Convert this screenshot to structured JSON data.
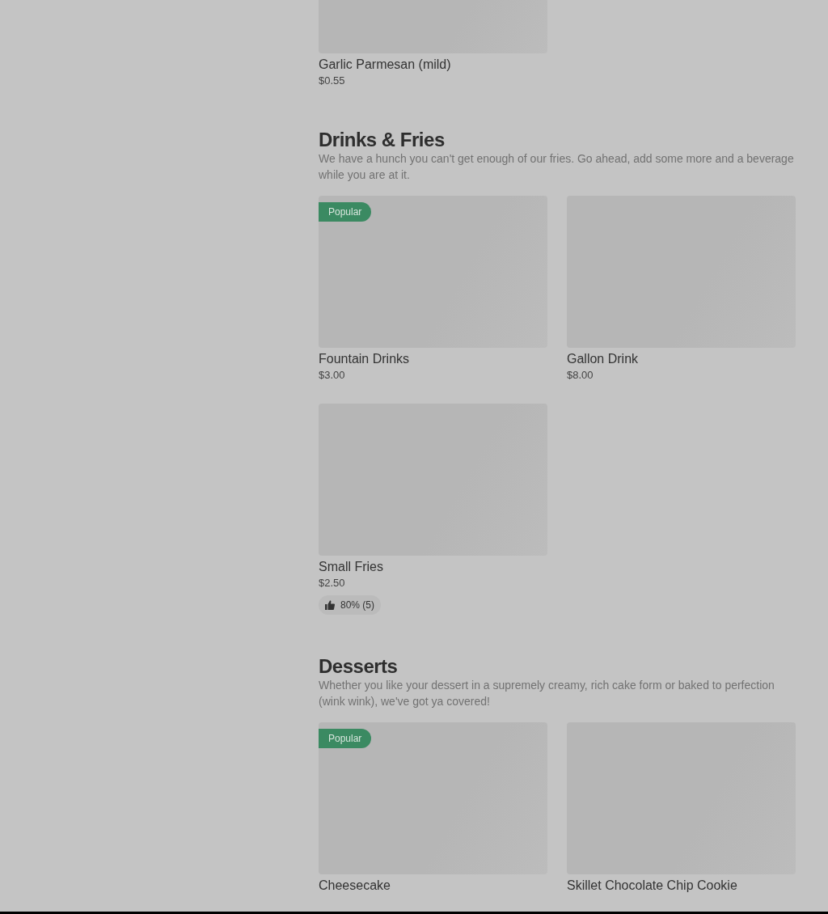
{
  "sections": [
    {
      "items": [
        {
          "name": "Garlic Parmesan (mild)",
          "price": "$0.55",
          "popular": false
        }
      ]
    },
    {
      "heading": "Drinks & Fries",
      "description": "We have a hunch you can't get enough of our fries. Go ahead, add some more and a beverage while you are at it.",
      "items": [
        {
          "name": "Fountain Drinks",
          "price": "$3.00",
          "popular": true,
          "popular_label": "Popular"
        },
        {
          "name": "Gallon Drink",
          "price": "$8.00",
          "popular": false
        },
        {
          "name": "Small Fries",
          "price": "$2.50",
          "popular": false,
          "rating": "80% (5)"
        }
      ]
    },
    {
      "heading": "Desserts",
      "description": "Whether you like your dessert in a supremely creamy, rich cake form or baked to perfection (wink wink), we've got ya covered!",
      "items": [
        {
          "name": "Cheesecake",
          "popular": true,
          "popular_label": "Popular"
        },
        {
          "name": "Skillet Chocolate Chip Cookie",
          "popular": false
        }
      ]
    }
  ]
}
